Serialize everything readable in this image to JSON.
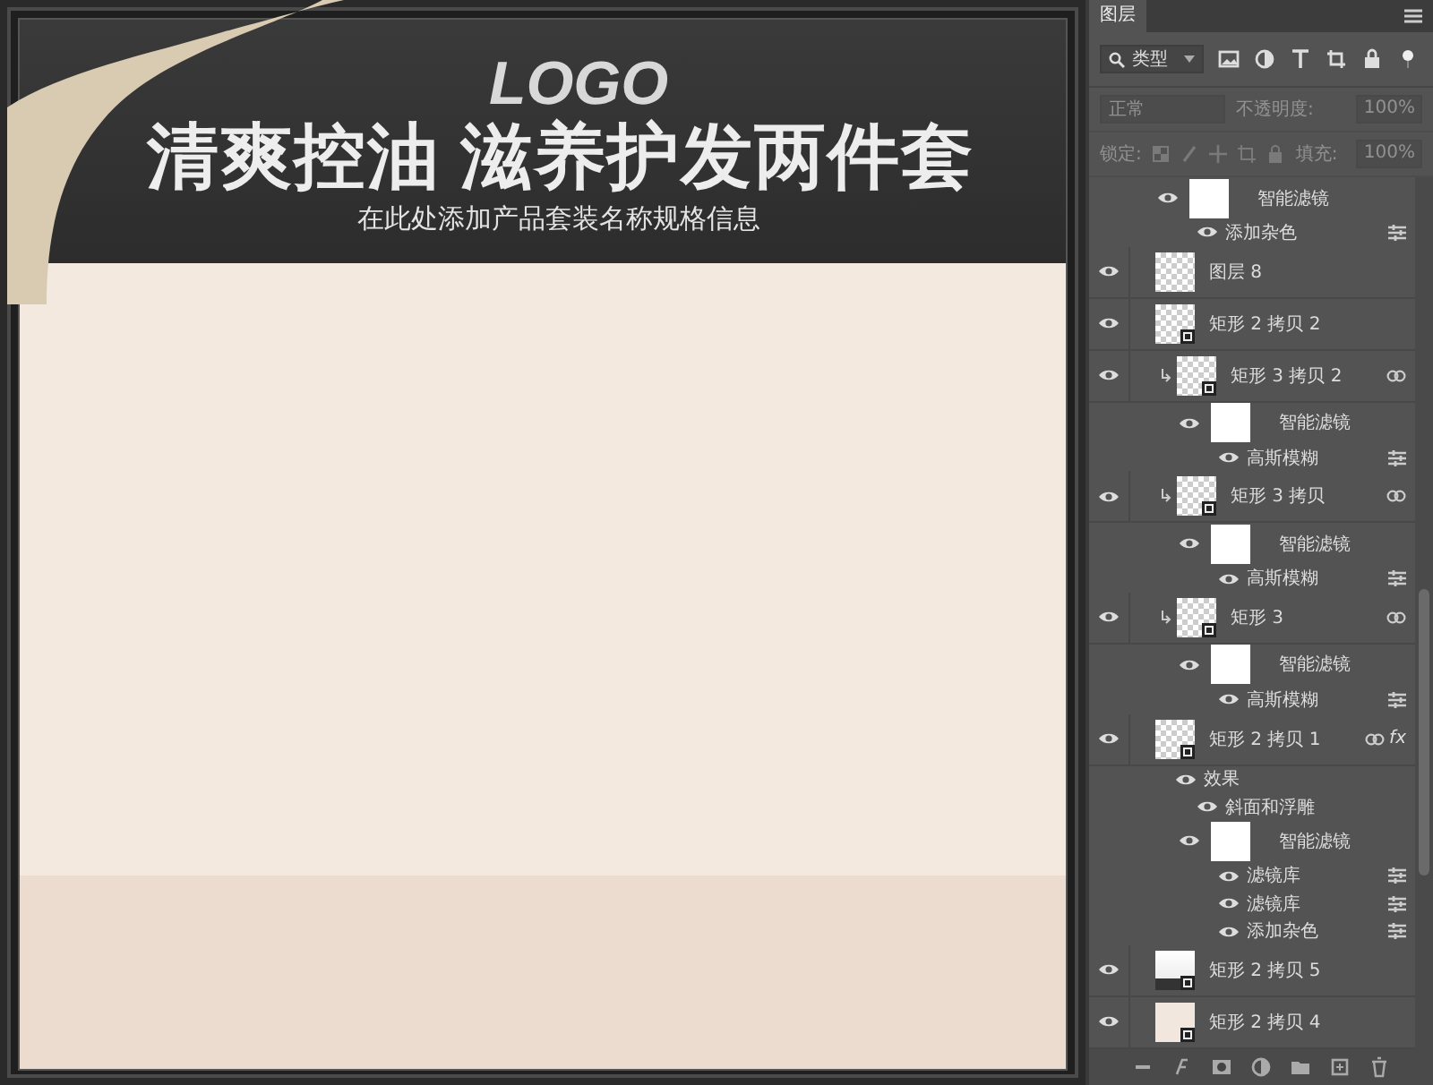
{
  "canvas": {
    "logo": "LOGO",
    "title": "清爽控油 滋养护发两件套",
    "subtitle": "在此处添加产品套装名称规格信息"
  },
  "panel": {
    "tabs": [
      {
        "label": "图层",
        "selected": true
      }
    ],
    "filter": {
      "value": "类型"
    },
    "blend": {
      "value": "正常",
      "opacity_label": "不透明度:",
      "opacity": "100%",
      "disabled": true
    },
    "lock": {
      "label": "锁定:",
      "fill_label": "填充:",
      "fill": "100%",
      "disabled": true
    },
    "layers": [
      {
        "name": "智能滤镜",
        "kind": "smart-filters",
        "visible": true,
        "children": [
          {
            "name": "添加杂色",
            "kind": "filter",
            "visible": true
          }
        ]
      },
      {
        "name": "图层 8",
        "kind": "layer",
        "visible": true,
        "thumb": {
          "kind": "checker"
        },
        "smart": false,
        "clipped": false
      },
      {
        "name": "矩形 2 拷贝 2",
        "kind": "layer",
        "visible": true,
        "thumb": {
          "kind": "checker"
        },
        "smart": true,
        "clipped": false
      },
      {
        "name": "矩形 3 拷贝 2",
        "kind": "layer",
        "visible": true,
        "thumb": {
          "kind": "checker"
        },
        "smart": true,
        "clipped": true,
        "linked": true,
        "children": [
          {
            "name": "智能滤镜",
            "kind": "smart-filters",
            "visible": true,
            "children": [
              {
                "name": "高斯模糊",
                "kind": "filter",
                "visible": true
              }
            ]
          }
        ]
      },
      {
        "name": "矩形 3 拷贝",
        "kind": "layer",
        "visible": true,
        "thumb": {
          "kind": "checker"
        },
        "smart": true,
        "clipped": true,
        "linked": true,
        "children": [
          {
            "name": "智能滤镜",
            "kind": "smart-filters",
            "visible": true,
            "children": [
              {
                "name": "高斯模糊",
                "kind": "filter",
                "visible": true
              }
            ]
          }
        ]
      },
      {
        "name": "矩形 3",
        "kind": "layer",
        "visible": true,
        "thumb": {
          "kind": "checker"
        },
        "smart": true,
        "clipped": true,
        "linked": true,
        "children": [
          {
            "name": "智能滤镜",
            "kind": "smart-filters",
            "visible": true,
            "children": [
              {
                "name": "高斯模糊",
                "kind": "filter",
                "visible": true
              }
            ]
          }
        ]
      },
      {
        "name": "矩形 2 拷贝 1",
        "kind": "layer",
        "visible": true,
        "thumb": {
          "kind": "checker"
        },
        "smart": true,
        "clipped": false,
        "linked": true,
        "badge": "fx",
        "children": [
          {
            "name": "效果",
            "kind": "effects",
            "visible": true,
            "children": [
              {
                "name": "斜面和浮雕",
                "kind": "effect",
                "visible": true
              }
            ]
          },
          {
            "name": "智能滤镜",
            "kind": "smart-filters",
            "visible": true,
            "children": [
              {
                "name": "滤镜库",
                "kind": "filter",
                "visible": true
              },
              {
                "name": "滤镜库",
                "kind": "filter",
                "visible": true
              },
              {
                "name": "添加杂色",
                "kind": "filter",
                "visible": true
              }
            ]
          }
        ]
      },
      {
        "name": "矩形 2 拷贝 5",
        "kind": "layer",
        "visible": true,
        "thumb": {
          "kind": "strip"
        },
        "smart": true,
        "clipped": false
      },
      {
        "name": "矩形 2 拷贝 4",
        "kind": "layer",
        "visible": true,
        "thumb": {
          "kind": "beige"
        },
        "smart": true,
        "clipped": false
      }
    ]
  }
}
